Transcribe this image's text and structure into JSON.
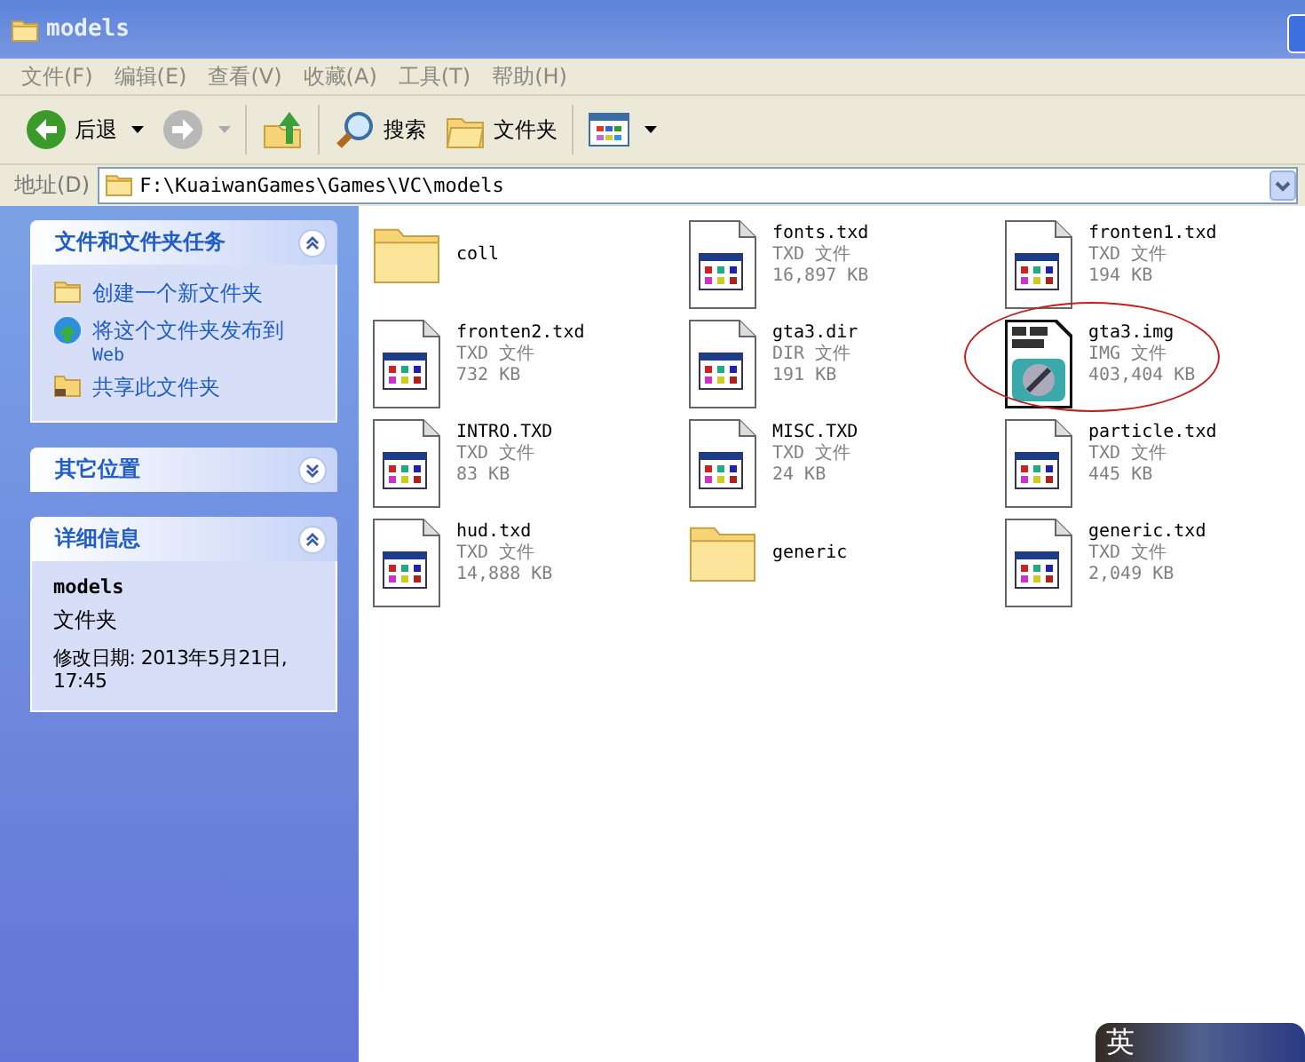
{
  "window": {
    "title": "models"
  },
  "menu": [
    "文件(F)",
    "编辑(E)",
    "查看(V)",
    "收藏(A)",
    "工具(T)",
    "帮助(H)"
  ],
  "toolbar": [
    {
      "kind": "back",
      "label": "后退"
    },
    {
      "kind": "forward"
    },
    {
      "kind": "up"
    },
    {
      "kind": "search",
      "label": "搜索"
    },
    {
      "kind": "folders",
      "label": "文件夹"
    },
    {
      "kind": "views"
    }
  ],
  "address": {
    "label": "地址(D)",
    "value": "F:\\KuaiwanGames\\Games\\VC\\models"
  },
  "sidebar": [
    {
      "title": "文件和文件夹任务",
      "expanded": true,
      "kind": "tasks",
      "items": [
        {
          "kind": "create",
          "label": "创建一个新文件夹"
        },
        {
          "kind": "publish",
          "label": "将这个文件夹发布到",
          "sub": "Web"
        },
        {
          "kind": "share",
          "label": "共享此文件夹"
        }
      ]
    },
    {
      "title": "其它位置",
      "expanded": false,
      "kind": "places"
    },
    {
      "title": "详细信息",
      "expanded": true,
      "kind": "details",
      "name": "models",
      "type": "文件夹",
      "modified": "修改日期: 2013年5月21日, 17:45"
    }
  ],
  "files": [
    {
      "kind": "folder",
      "name": "coll",
      "circled": false
    },
    {
      "kind": "doc",
      "name": "fonts.txd",
      "type": "TXD 文件",
      "size": "16,897 KB",
      "circled": false
    },
    {
      "kind": "doc",
      "name": "fronten1.txd",
      "type": "TXD 文件",
      "size": "194 KB",
      "circled": false
    },
    {
      "kind": "doc",
      "name": "fronten2.txd",
      "type": "TXD 文件",
      "size": "732 KB",
      "circled": false
    },
    {
      "kind": "doc",
      "name": "gta3.dir",
      "type": "DIR 文件",
      "size": "191 KB",
      "circled": false
    },
    {
      "kind": "img",
      "name": "gta3.img",
      "type": "IMG 文件",
      "size": "403,404 KB",
      "circled": true
    },
    {
      "kind": "doc",
      "name": "INTRO.TXD",
      "type": "TXD 文件",
      "size": "83 KB",
      "circled": false
    },
    {
      "kind": "doc",
      "name": "MISC.TXD",
      "type": "TXD 文件",
      "size": "24 KB",
      "circled": false
    },
    {
      "kind": "doc",
      "name": "particle.txd",
      "type": "TXD 文件",
      "size": "445 KB",
      "circled": false
    },
    {
      "kind": "doc",
      "name": "hud.txd",
      "type": "TXD 文件",
      "size": "14,888 KB",
      "circled": false
    },
    {
      "kind": "folder",
      "name": "generic",
      "circled": false
    },
    {
      "kind": "doc",
      "name": "generic.txd",
      "type": "TXD 文件",
      "size": "2,049 KB",
      "circled": false
    }
  ],
  "ime": {
    "label": "英"
  }
}
